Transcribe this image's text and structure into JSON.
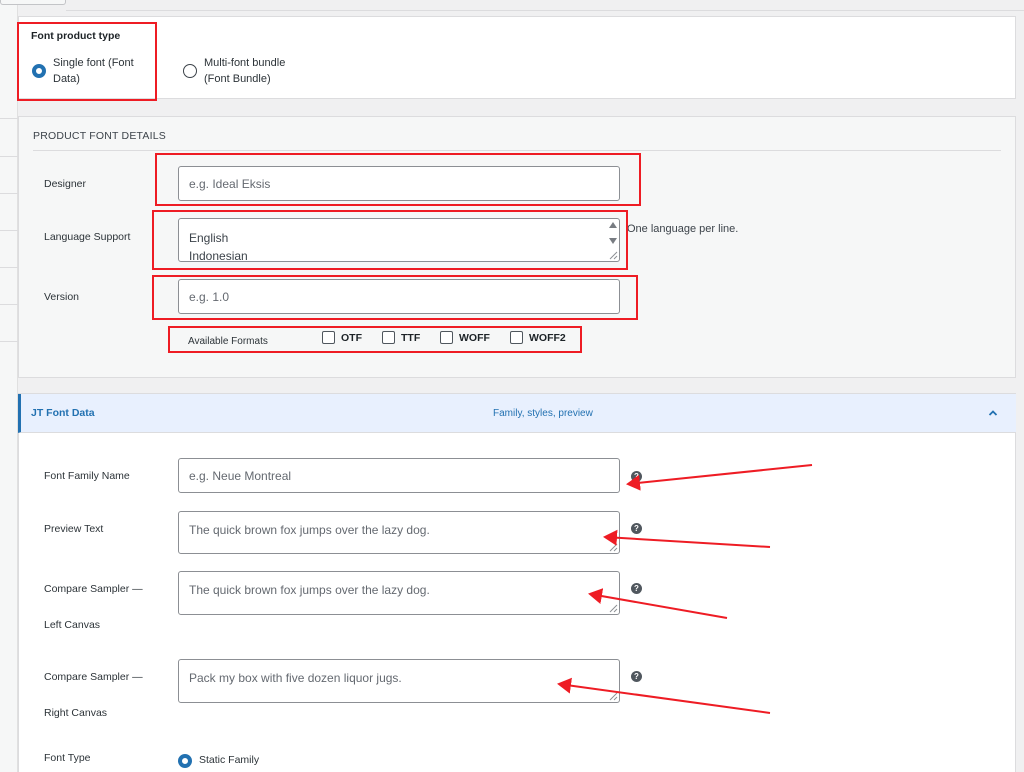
{
  "font_product_type": {
    "title": "Font product type",
    "options": [
      {
        "label_line1": "Single font (Font",
        "label_line2": "Data)",
        "selected": true
      },
      {
        "label_line1": "Multi-font bundle",
        "label_line2": "(Font Bundle)",
        "selected": false
      }
    ]
  },
  "product_font_details": {
    "heading": "PRODUCT FONT DETAILS",
    "designer": {
      "label": "Designer",
      "placeholder": "e.g. Ideal Eksis"
    },
    "language_support": {
      "label": "Language Support",
      "lines": [
        "English",
        "Indonesian"
      ],
      "help": "One language per line."
    },
    "version": {
      "label": "Version",
      "placeholder": "e.g. 1.0"
    },
    "available_formats": {
      "label": "Available Formats",
      "options": [
        "OTF",
        "TTF",
        "WOFF",
        "WOFF2"
      ]
    }
  },
  "jt_font_data": {
    "title": "JT Font Data",
    "subtitle": "Family, styles, preview",
    "font_family_name": {
      "label": "Font Family Name",
      "placeholder": "e.g. Neue Montreal"
    },
    "preview_text": {
      "label": "Preview Text",
      "placeholder": "The quick brown fox jumps over the lazy dog."
    },
    "compare_left": {
      "label_line1": "Compare Sampler —",
      "label_line2": "Left Canvas",
      "placeholder": "The quick brown fox jumps over the lazy dog."
    },
    "compare_right": {
      "label_line1": "Compare Sampler —",
      "label_line2": "Right Canvas",
      "placeholder": "Pack my box with five dozen liquor jugs."
    },
    "font_type": {
      "label": "Font Type",
      "option": "Static Family"
    }
  },
  "colors": {
    "accent": "#2271b1",
    "annotation_red": "#ee1c24"
  },
  "icons": [
    "help-icon",
    "chevron-up-icon",
    "resize-handle-icon",
    "scroll-arrow-icon"
  ]
}
